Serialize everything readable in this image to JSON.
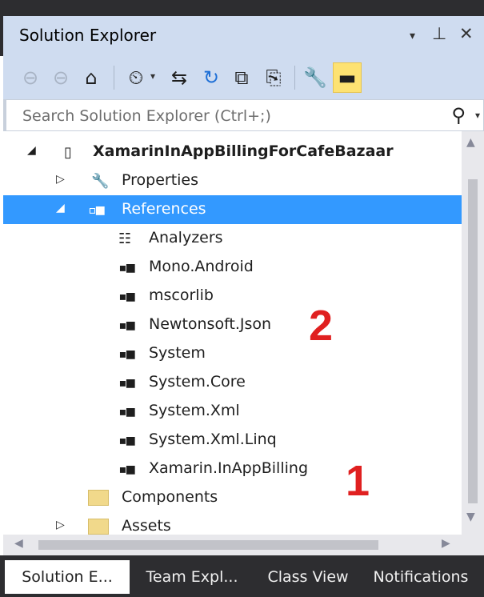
{
  "window": {
    "title": "Solution Explorer",
    "dropdown_glyph": "▾",
    "pin_glyph": "⊥",
    "close_glyph": "✕"
  },
  "toolbar": {
    "icons": [
      "back-icon",
      "forward-icon",
      "home-icon",
      "pending-changes-filter-icon",
      "sync-with-active-document-icon",
      "refresh-icon",
      "collapse-all-icon",
      "show-all-files-icon",
      "properties-icon",
      "preview-selected-items-icon"
    ]
  },
  "search": {
    "placeholder": "Search Solution Explorer (Ctrl+;)"
  },
  "tree": {
    "items": [
      {
        "label": "XamarinInAppBillingForCafeBazaar",
        "icon": "android-project-icon",
        "expanded": true,
        "bold": true
      },
      {
        "label": "Properties",
        "icon": "wrench-icon",
        "expanded": false
      },
      {
        "label": "References",
        "icon": "references-icon",
        "expanded": true,
        "selected": true
      },
      {
        "label": "Analyzers",
        "icon": "analyzers-icon"
      },
      {
        "label": "Mono.Android",
        "icon": "reference-icon"
      },
      {
        "label": "mscorlib",
        "icon": "reference-icon"
      },
      {
        "label": "Newtonsoft.Json",
        "icon": "reference-icon"
      },
      {
        "label": "System",
        "icon": "reference-icon"
      },
      {
        "label": "System.Core",
        "icon": "reference-icon"
      },
      {
        "label": "System.Xml",
        "icon": "reference-icon"
      },
      {
        "label": "System.Xml.Linq",
        "icon": "reference-icon"
      },
      {
        "label": "Xamarin.InAppBilling",
        "icon": "reference-icon"
      },
      {
        "label": "Components",
        "icon": "folder-icon"
      },
      {
        "label": "Assets",
        "icon": "folder-icon",
        "expanded": false
      }
    ]
  },
  "annotations": {
    "one": "1",
    "two": "2"
  },
  "tabs": [
    {
      "label": "Solution E...",
      "active": true
    },
    {
      "label": "Team Expl...",
      "active": false
    },
    {
      "label": "Class View",
      "active": false
    },
    {
      "label": "Notifications",
      "active": false
    }
  ],
  "colors": {
    "selection": "#3399ff",
    "chrome": "#cfdcf0",
    "tab_bar": "#2d2d30",
    "annotation": "#e02020"
  }
}
